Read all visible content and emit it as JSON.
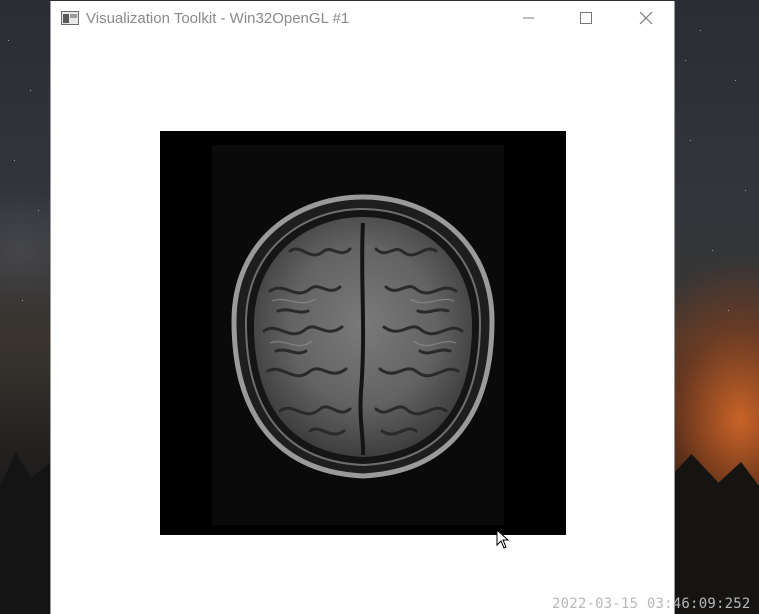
{
  "window": {
    "title": "Visualization Toolkit - Win32OpenGL #1",
    "controls": {
      "minimize_icon": "minimize-icon",
      "maximize_icon": "maximize-icon",
      "close_icon": "close-icon"
    }
  },
  "render": {
    "content": "brain-mri-axial-slice",
    "background_color": "#ffffff",
    "image_background": "#000000"
  },
  "overlay": {
    "timestamp": "2022-03-15 03:46:09:252"
  }
}
